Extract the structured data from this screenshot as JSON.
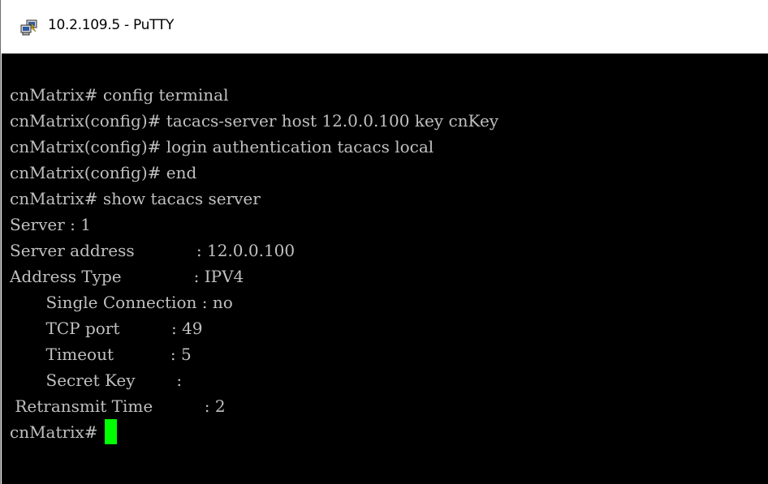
{
  "window": {
    "title": "10.2.109.5 - PuTTY",
    "icon": "putty-icon"
  },
  "terminal": {
    "lines": [
      "cnMatrix# config terminal",
      "cnMatrix(config)# tacacs-server host 12.0.0.100 key cnKey",
      "cnMatrix(config)# login authentication tacacs local",
      "cnMatrix(config)# end",
      "cnMatrix# show tacacs server",
      "Server : 1",
      "Server address            : 12.0.0.100",
      "Address Type              : IPV4",
      "       Single Connection : no",
      "       TCP port          : 49",
      "       Timeout           : 5",
      "       Secret Key        :",
      " Retransmit Time          : 2"
    ],
    "prompt": "cnMatrix# ",
    "colors": {
      "background": "#000000",
      "foreground": "#c0c0c0",
      "cursor": "#00ff00"
    }
  }
}
